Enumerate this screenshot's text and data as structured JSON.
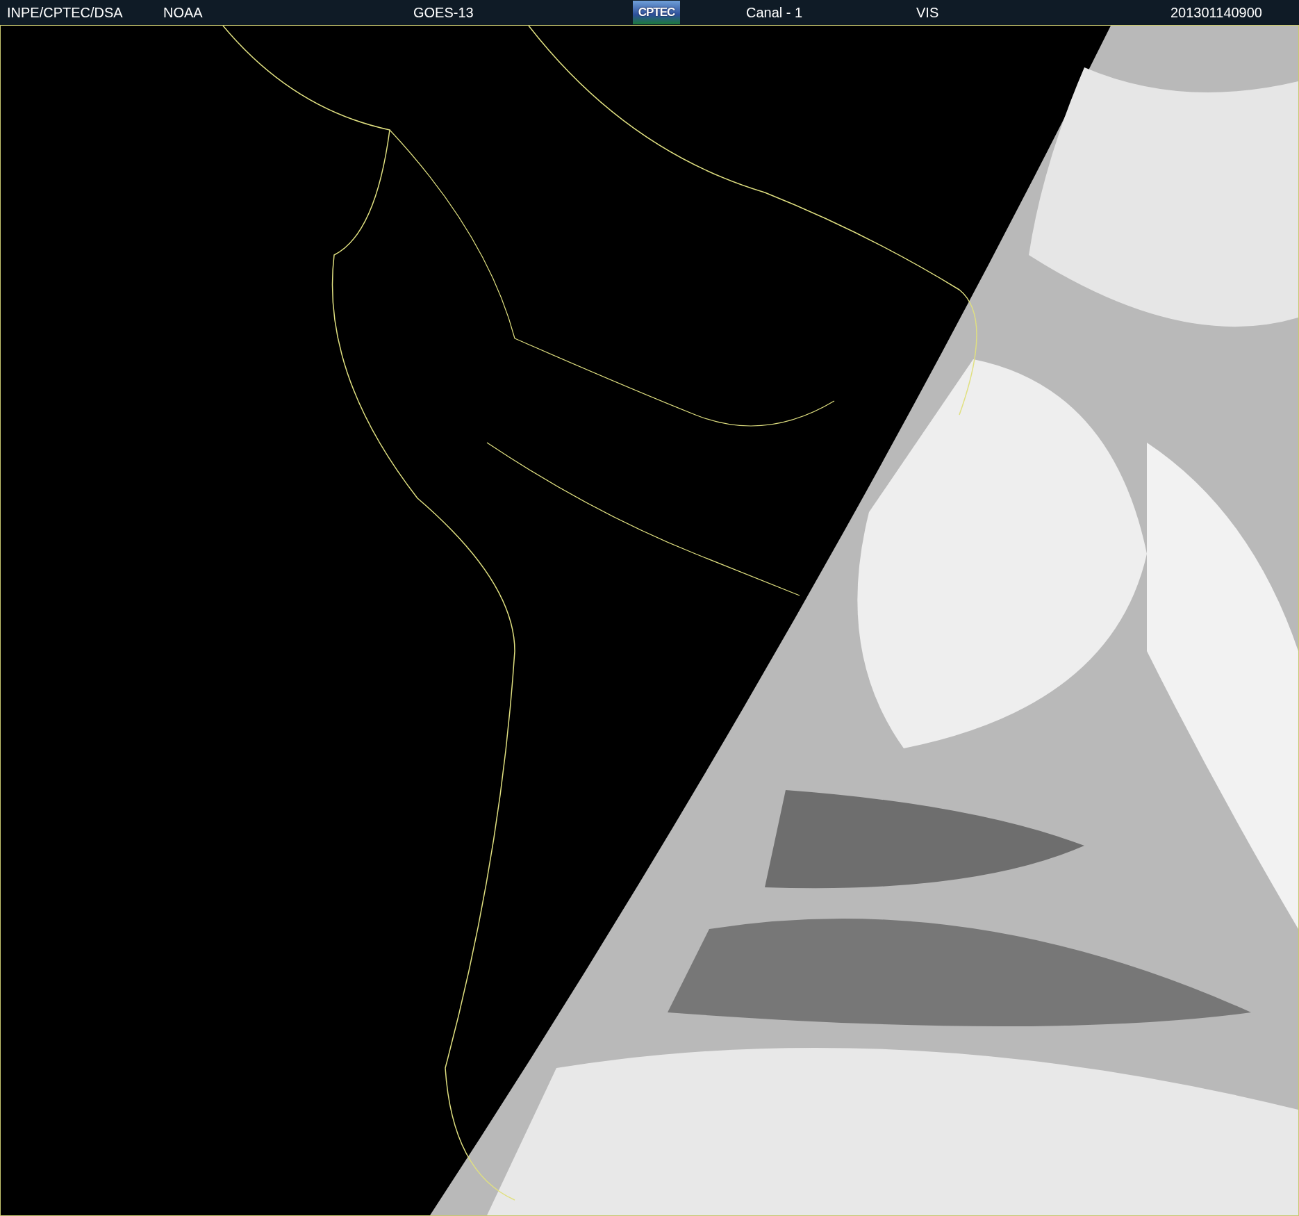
{
  "header": {
    "source": "INPE/CPTEC/DSA",
    "agency": "NOAA",
    "satellite": "GOES-13",
    "logo": "CPTEC",
    "channel": "Canal - 1",
    "band": "VIS",
    "timestamp": "201301140900"
  }
}
